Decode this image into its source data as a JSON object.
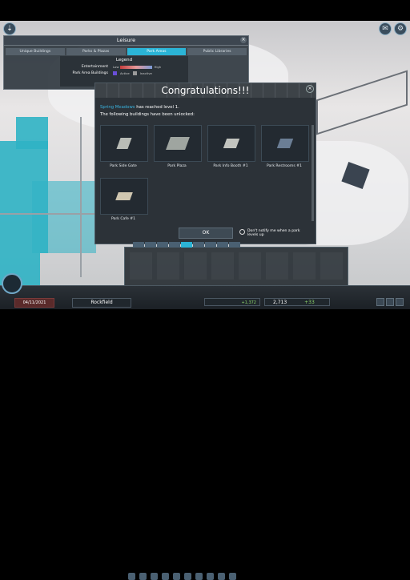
{
  "window": {
    "top_icons": [
      "chirper-settings-icon",
      "gear-icon"
    ]
  },
  "info_panel": {
    "title": "Leisure",
    "tabs": [
      "Unique Buildings",
      "Parks & Plazas",
      "Park Areas",
      "Public Libraries"
    ],
    "active_tab_index": 2,
    "legend": {
      "title": "Legend",
      "entertainment_label": "Entertainment",
      "low": "Low",
      "high": "High",
      "park_area_label": "Park Area Buildings",
      "active": "Active",
      "inactive": "Inactive",
      "active_color": "#6a4fd8",
      "inactive_color": "#9a9a9a"
    }
  },
  "dialog": {
    "title": "Congratulations!!!",
    "park_name": "Spring Meadows",
    "level_text": "has reached level 1.",
    "unlock_text": "The following buildings have been unlocked:",
    "buildings": [
      {
        "name": "Park Side Gate"
      },
      {
        "name": "Park Plaza"
      },
      {
        "name": "Park Info Booth #1"
      },
      {
        "name": "Park Restrooms #1"
      },
      {
        "name": "Park Cafe #1"
      }
    ],
    "ok_label": "OK",
    "notify_label": "Don't notify me when a park levels up"
  },
  "bottom_bar": {
    "city_name": "Rockfield",
    "population": "2,713",
    "date": "04/11/2021",
    "cash": "+1,372",
    "income": "+33"
  },
  "colors": {
    "accent": "#2bb4d6",
    "city_overlay": "#2fb3c4"
  }
}
